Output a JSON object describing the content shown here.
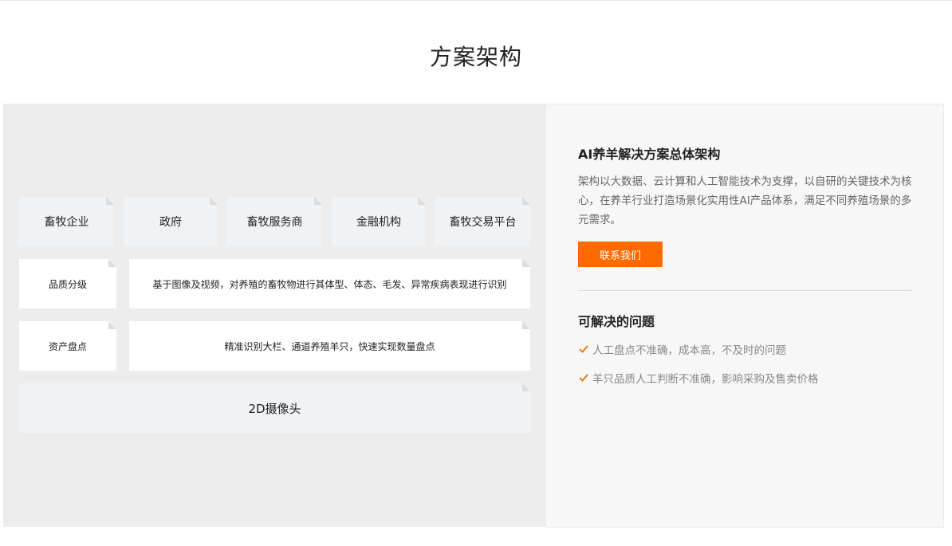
{
  "page": {
    "title": "方案架构"
  },
  "architecture": {
    "stakeholders": [
      "畜牧企业",
      "政府",
      "畜牧服务商",
      "金融机构",
      "畜牧交易平台"
    ],
    "capabilities": [
      {
        "name": "品质分级",
        "description": "基于图像及视频，对养殖的畜牧物进行其体型、体态、毛发、异常疾病表现进行识别"
      },
      {
        "name": "资产盘点",
        "description": "精准识别大栏、通道养殖羊只，快速实现数量盘点"
      }
    ],
    "device": "2D摄像头"
  },
  "solution": {
    "title": "AI养羊解决方案总体架构",
    "description": "架构以大数据、云计算和人工智能技术为支撑，以自研的关键技术为核心，在养羊行业打造场景化实用性AI产品体系，满足不同养殖场景的多元需求。",
    "contact_label": "联系我们",
    "problems_title": "可解决的问题",
    "problems": [
      "人工盘点不准确，成本高，不及时的问题",
      "羊只品质人工判断不准确，影响采购及售卖价格"
    ],
    "accent_color": "#ff6a00"
  }
}
